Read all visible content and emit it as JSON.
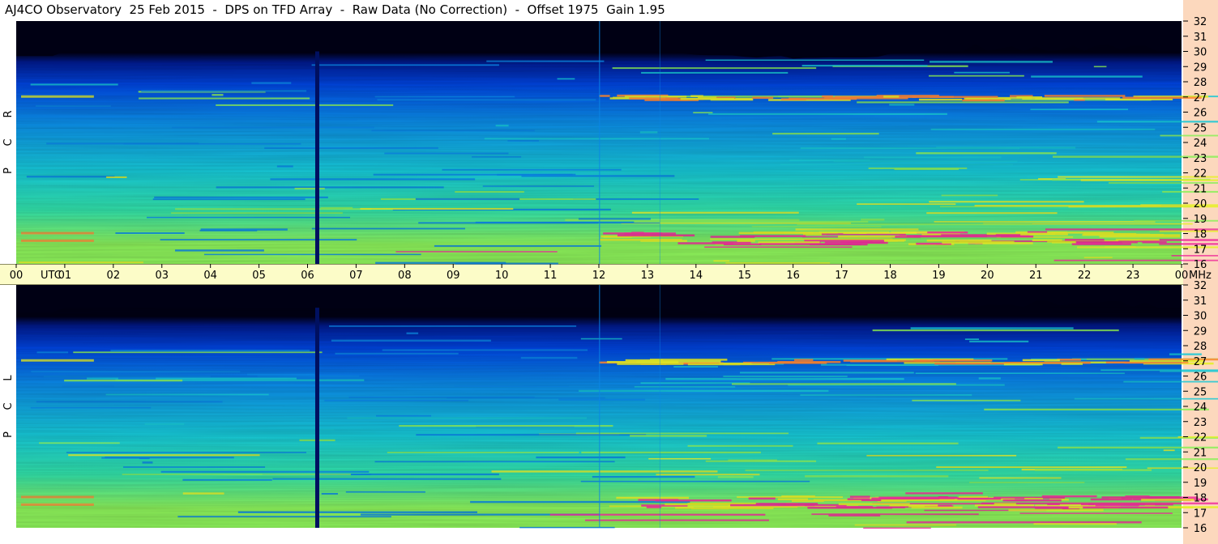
{
  "title": "AJ4CO Observatory  25 Feb 2015  -  DPS on TFD Array  -  Raw Data (No Correction)  -  Offset 1975  Gain 1.95",
  "chart_data": [
    {
      "type": "heatmap",
      "panel": "RCP",
      "ylabel": "R C P",
      "x": {
        "ticks": [
          "00",
          "01",
          "02",
          "03",
          "04",
          "05",
          "06",
          "07",
          "08",
          "09",
          "10",
          "11",
          "12",
          "13",
          "14",
          "15",
          "16",
          "17",
          "18",
          "19",
          "20",
          "21",
          "22",
          "23",
          "00"
        ],
        "unit": "UTC",
        "range_hours": [
          0,
          24
        ]
      },
      "y": {
        "ticks": [
          16,
          17,
          18,
          19,
          20,
          21,
          22,
          23,
          24,
          25,
          26,
          27,
          28,
          29,
          30,
          31,
          32
        ],
        "unit": "MHz",
        "range": [
          16,
          32
        ]
      },
      "colormap": [
        "#000014",
        "#001a8c",
        "#0044dd",
        "#0a86e6",
        "#17c8d6",
        "#32e0a8",
        "#8cf05a",
        "#e6f02a",
        "#ff8a3a",
        "#f0349c"
      ],
      "features": {
        "dark_top_band_mhz": [
          30,
          32
        ],
        "vertical_gap_utc": 6.2,
        "bright_bands_mhz": [
          27,
          17.5,
          18
        ]
      }
    },
    {
      "type": "heatmap",
      "panel": "LCP",
      "ylabel": "L C P",
      "x": {
        "ticks": [
          "00",
          "01",
          "02",
          "03",
          "04",
          "05",
          "06",
          "07",
          "08",
          "09",
          "10",
          "11",
          "12",
          "13",
          "14",
          "15",
          "16",
          "17",
          "18",
          "19",
          "20",
          "21",
          "22",
          "23",
          "00"
        ],
        "unit": "UTC",
        "range_hours": [
          0,
          24
        ]
      },
      "y": {
        "ticks": [
          16,
          17,
          18,
          19,
          20,
          21,
          22,
          23,
          24,
          25,
          26,
          27,
          28,
          29,
          30,
          31,
          32
        ],
        "unit": "MHz",
        "range": [
          16,
          32
        ]
      },
      "colormap": [
        "#000014",
        "#001a8c",
        "#0044dd",
        "#0a86e6",
        "#17c8d6",
        "#32e0a8",
        "#8cf05a",
        "#e6f02a",
        "#ff8a3a",
        "#f0349c"
      ],
      "features": {
        "dark_top_band_mhz": [
          30.5,
          32
        ],
        "vertical_gap_utc": 6.2,
        "bright_bands_mhz": [
          27,
          17.5,
          18
        ]
      }
    }
  ],
  "time_axis": {
    "utc_label": "UTC",
    "mhz_label": "MHz"
  }
}
